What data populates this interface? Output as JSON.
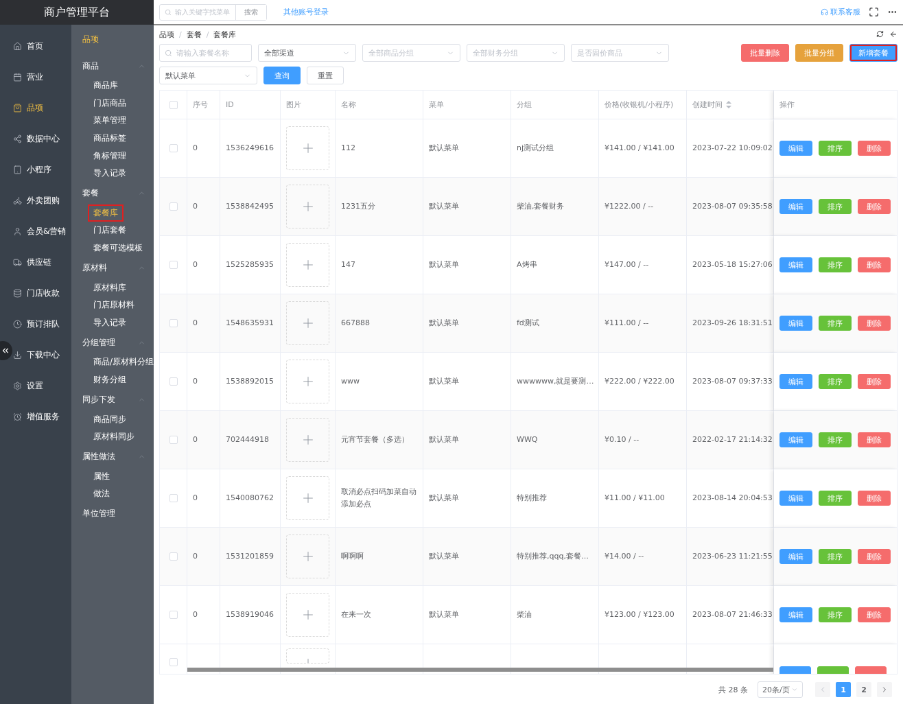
{
  "brand": "商户管理平台",
  "topbar": {
    "search": {
      "placeholder": "输入关键字找菜单",
      "button": "搜索"
    },
    "link": "其他账号登录",
    "service": "联系客服"
  },
  "nav": [
    {
      "label": "首页",
      "selected": false
    },
    {
      "label": "营业",
      "selected": false
    },
    {
      "label": "品项",
      "selected": true
    },
    {
      "label": "数据中心",
      "selected": false
    },
    {
      "label": "小程序",
      "selected": false
    },
    {
      "label": "外卖团购",
      "selected": false
    },
    {
      "label": "会员&营销",
      "selected": false
    },
    {
      "label": "供应链",
      "selected": false
    },
    {
      "label": "门店收款",
      "selected": false
    },
    {
      "label": "预订排队",
      "selected": false
    },
    {
      "label": "下载中心",
      "selected": false
    },
    {
      "label": "设置",
      "selected": false
    },
    {
      "label": "增值服务",
      "selected": false
    }
  ],
  "submenu": {
    "title": "品项",
    "groups": [
      {
        "label": "商品",
        "expanded": true,
        "items": [
          {
            "label": "商品库",
            "selected": false,
            "highlighted": false
          },
          {
            "label": "门店商品",
            "selected": false,
            "highlighted": false
          },
          {
            "label": "菜单管理",
            "selected": false,
            "highlighted": false
          },
          {
            "label": "商品标签",
            "selected": false,
            "highlighted": false
          },
          {
            "label": "角标管理",
            "selected": false,
            "highlighted": false
          },
          {
            "label": "导入记录",
            "selected": false,
            "highlighted": false
          }
        ]
      },
      {
        "label": "套餐",
        "expanded": true,
        "items": [
          {
            "label": "套餐库",
            "selected": true,
            "highlighted": true
          },
          {
            "label": "门店套餐",
            "selected": false,
            "highlighted": false
          },
          {
            "label": "套餐可选模板",
            "selected": false,
            "highlighted": false
          }
        ]
      },
      {
        "label": "原材料",
        "expanded": true,
        "items": [
          {
            "label": "原材料库",
            "selected": false,
            "highlighted": false
          },
          {
            "label": "门店原材料",
            "selected": false,
            "highlighted": false
          },
          {
            "label": "导入记录",
            "selected": false,
            "highlighted": false
          }
        ]
      },
      {
        "label": "分组管理",
        "expanded": true,
        "items": [
          {
            "label": "商品/原材料分组",
            "selected": false,
            "highlighted": false
          },
          {
            "label": "财务分组",
            "selected": false,
            "highlighted": false
          }
        ]
      },
      {
        "label": "同步下发",
        "expanded": true,
        "items": [
          {
            "label": "商品同步",
            "selected": false,
            "highlighted": false
          },
          {
            "label": "原材料同步",
            "selected": false,
            "highlighted": false
          }
        ]
      },
      {
        "label": "属性做法",
        "expanded": true,
        "items": [
          {
            "label": "属性",
            "selected": false,
            "highlighted": false
          },
          {
            "label": "做法",
            "selected": false,
            "highlighted": false
          }
        ]
      },
      {
        "label": "单位管理",
        "expanded": false
      }
    ]
  },
  "breadcrumb": {
    "items": [
      "品项",
      "套餐",
      "套餐库"
    ],
    "separators": [
      "/",
      "/"
    ]
  },
  "filters": [
    {
      "kind": "search",
      "placeholder": "请输入套餐名称"
    },
    {
      "kind": "select",
      "value": "全部渠道"
    },
    {
      "kind": "select",
      "placeholder": "全部商品分组"
    },
    {
      "kind": "select",
      "placeholder": "全部财务分组"
    },
    {
      "kind": "select",
      "placeholder": "是否固价商品"
    },
    {
      "kind": "select",
      "value": "默认菜单"
    }
  ],
  "filter_buttons": [
    {
      "label": "查询",
      "kind": "primary"
    },
    {
      "label": "重置",
      "kind": "plain"
    }
  ],
  "bulk_buttons": [
    {
      "label": "批量删除",
      "kind": "danger",
      "highlighted": false
    },
    {
      "label": "批量分组",
      "kind": "warning",
      "highlighted": false
    },
    {
      "label": "新增套餐",
      "kind": "primary",
      "highlighted": true
    }
  ],
  "table": {
    "header_checked": false,
    "columns": [
      {
        "label": "序号",
        "sortable": false
      },
      {
        "label": "ID",
        "sortable": false
      },
      {
        "label": "图片",
        "sortable": false
      },
      {
        "label": "名称",
        "sortable": false
      },
      {
        "label": "菜单",
        "sortable": false
      },
      {
        "label": "分组",
        "sortable": false
      },
      {
        "label": "价格(收银机/小程序)",
        "sortable": false
      },
      {
        "label": "创建时间",
        "sortable": true
      },
      {
        "label": "操作",
        "sortable": false
      }
    ],
    "rows": [
      {
        "checked": false,
        "index": "0",
        "id": "1536249616",
        "name": "112",
        "menu": "默认菜单",
        "group": "nj测试分组",
        "price": "¥141.00 / ¥141.00",
        "created": "2023-07-22 10:09:02",
        "actions": [
          "编辑",
          "排序",
          "删除"
        ]
      },
      {
        "checked": false,
        "index": "0",
        "id": "1538842495",
        "name": "1231五分",
        "menu": "默认菜单",
        "group": "柴油,套餐财务",
        "price": "¥1222.00 / --",
        "created": "2023-08-07 09:35:58",
        "actions": [
          "编辑",
          "排序",
          "删除"
        ]
      },
      {
        "checked": false,
        "index": "0",
        "id": "1525285935",
        "name": "147",
        "menu": "默认菜单",
        "group": "A烤串",
        "price": "¥147.00 / --",
        "created": "2023-05-18 15:27:06",
        "actions": [
          "编辑",
          "排序",
          "删除"
        ]
      },
      {
        "checked": false,
        "index": "0",
        "id": "1548635931",
        "name": "667888",
        "menu": "默认菜单",
        "group": "fd测试",
        "price": "¥111.00 / --",
        "created": "2023-09-26 18:31:51",
        "actions": [
          "编辑",
          "排序",
          "删除"
        ]
      },
      {
        "checked": false,
        "index": "0",
        "id": "1538892015",
        "name": "www",
        "menu": "默认菜单",
        "group": "wwwwww,就是要测…",
        "price": "¥222.00 / ¥222.00",
        "created": "2023-08-07 09:37:33",
        "actions": [
          "编辑",
          "排序",
          "删除"
        ]
      },
      {
        "checked": false,
        "index": "0",
        "id": "702444918",
        "name": "元宵节套餐（多选）",
        "menu": "默认菜单",
        "group": "WWQ",
        "price": "¥0.10 / --",
        "created": "2022-02-17 21:14:32",
        "actions": [
          "编辑",
          "排序",
          "删除"
        ]
      },
      {
        "checked": false,
        "index": "0",
        "id": "1540080762",
        "name": "取消必点扫码加菜自动添加必点",
        "menu": "默认菜单",
        "group": "特别推荐",
        "price": "¥11.00 / ¥11.00",
        "created": "2023-08-14 20:04:53",
        "actions": [
          "编辑",
          "排序",
          "删除"
        ]
      },
      {
        "checked": false,
        "index": "0",
        "id": "1531201859",
        "name": "啊啊啊",
        "menu": "默认菜单",
        "group": "特别推荐,qqq,套餐…",
        "price": "¥14.00 / --",
        "created": "2023-06-23 11:21:55",
        "actions": [
          "编辑",
          "排序",
          "删除"
        ]
      },
      {
        "checked": false,
        "index": "0",
        "id": "1538919046",
        "name": "在来一次",
        "menu": "默认菜单",
        "group": "柴油",
        "price": "¥123.00 / ¥123.00",
        "created": "2023-08-07 21:46:33",
        "actions": [
          "编辑",
          "排序",
          "删除"
        ]
      }
    ],
    "partial_row": {
      "checked": false
    }
  },
  "pagination": {
    "total": "共 28 条",
    "page_size": "20条/页",
    "pages": [
      {
        "label": "1",
        "selected": true
      },
      {
        "label": "2",
        "selected": false
      }
    ]
  }
}
